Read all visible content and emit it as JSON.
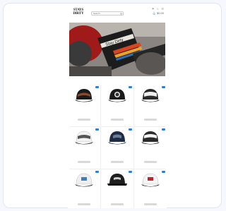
{
  "header": {
    "logo": "STAYS\nDIRTY",
    "search_placeholder": "Search",
    "top_icons": [
      "⚑",
      "☺",
      "☰"
    ],
    "cart": "⚓ $0.00"
  },
  "nav": {
    "items": [
      "",
      "",
      "",
      "",
      "",
      "",
      ""
    ]
  },
  "hero": {
    "image_text": "Stay Dirty",
    "brand_accent": "#c8102e"
  },
  "section_title": "",
  "products": [
    {
      "name": "",
      "price": "",
      "badge_color": "#2f7fd9",
      "icon": "trucker-cap-icon",
      "style": "black-brown"
    },
    {
      "name": "",
      "price": "",
      "badge_color": "#2f7fd9",
      "icon": "trucker-cap-icon",
      "style": "black-round-patch"
    },
    {
      "name": "",
      "price": "",
      "badge_color": "#2f7fd9",
      "icon": "trucker-cap-icon",
      "style": "black-white"
    },
    {
      "name": "",
      "price": "",
      "badge_color": "#2f7fd9",
      "icon": "trucker-cap-icon",
      "style": "white-black"
    },
    {
      "name": "",
      "price": "",
      "badge_color": "#2f7fd9",
      "icon": "trucker-cap-icon",
      "style": "navy"
    },
    {
      "name": "",
      "price": "",
      "badge_color": "#2f7fd9",
      "icon": "trucker-cap-icon",
      "style": "black-white-2"
    },
    {
      "name": "",
      "price": "",
      "badge_color": "#2f7fd9",
      "icon": "trucker-cap-icon",
      "style": "white-blue-patch"
    },
    {
      "name": "",
      "price": "",
      "badge_color": "#2f7fd9",
      "icon": "trucker-cap-icon",
      "style": "black-flat"
    },
    {
      "name": "",
      "price": "",
      "badge_color": "#2f7fd9",
      "icon": "trucker-cap-icon",
      "style": "white-red-patch"
    }
  ]
}
